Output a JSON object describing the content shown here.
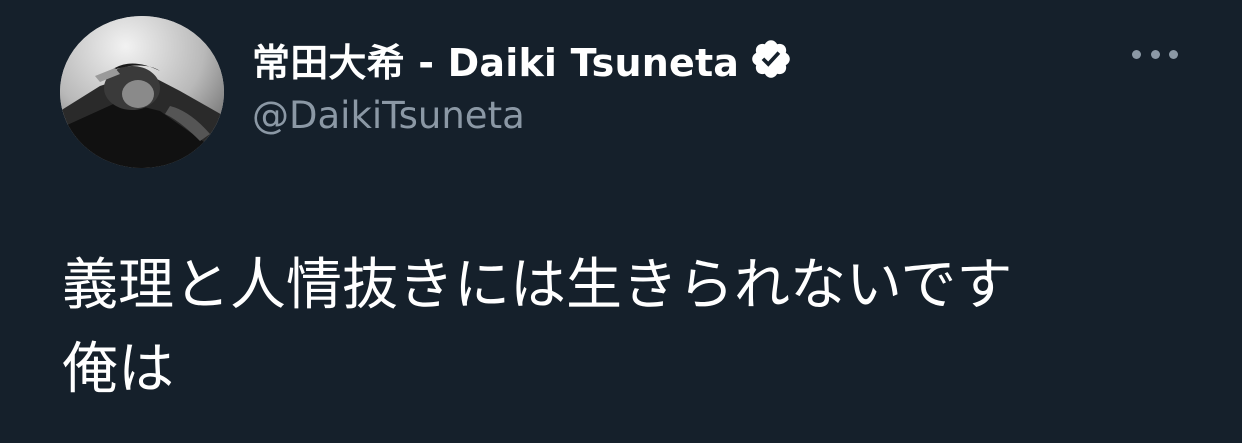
{
  "tweet": {
    "author": {
      "display_name": "常田大希 - Daiki Tsuneta",
      "handle": "@DaikiTsuneta",
      "verified_icon": "verified-badge-icon"
    },
    "text_lines": [
      "義理と人情抜きには生きられないです",
      "俺は"
    ],
    "more_icon": "more-options-icon"
  },
  "colors": {
    "background": "#15202b",
    "name": "#ffffff",
    "handle": "#8b98a5",
    "body": "#ffffff"
  }
}
